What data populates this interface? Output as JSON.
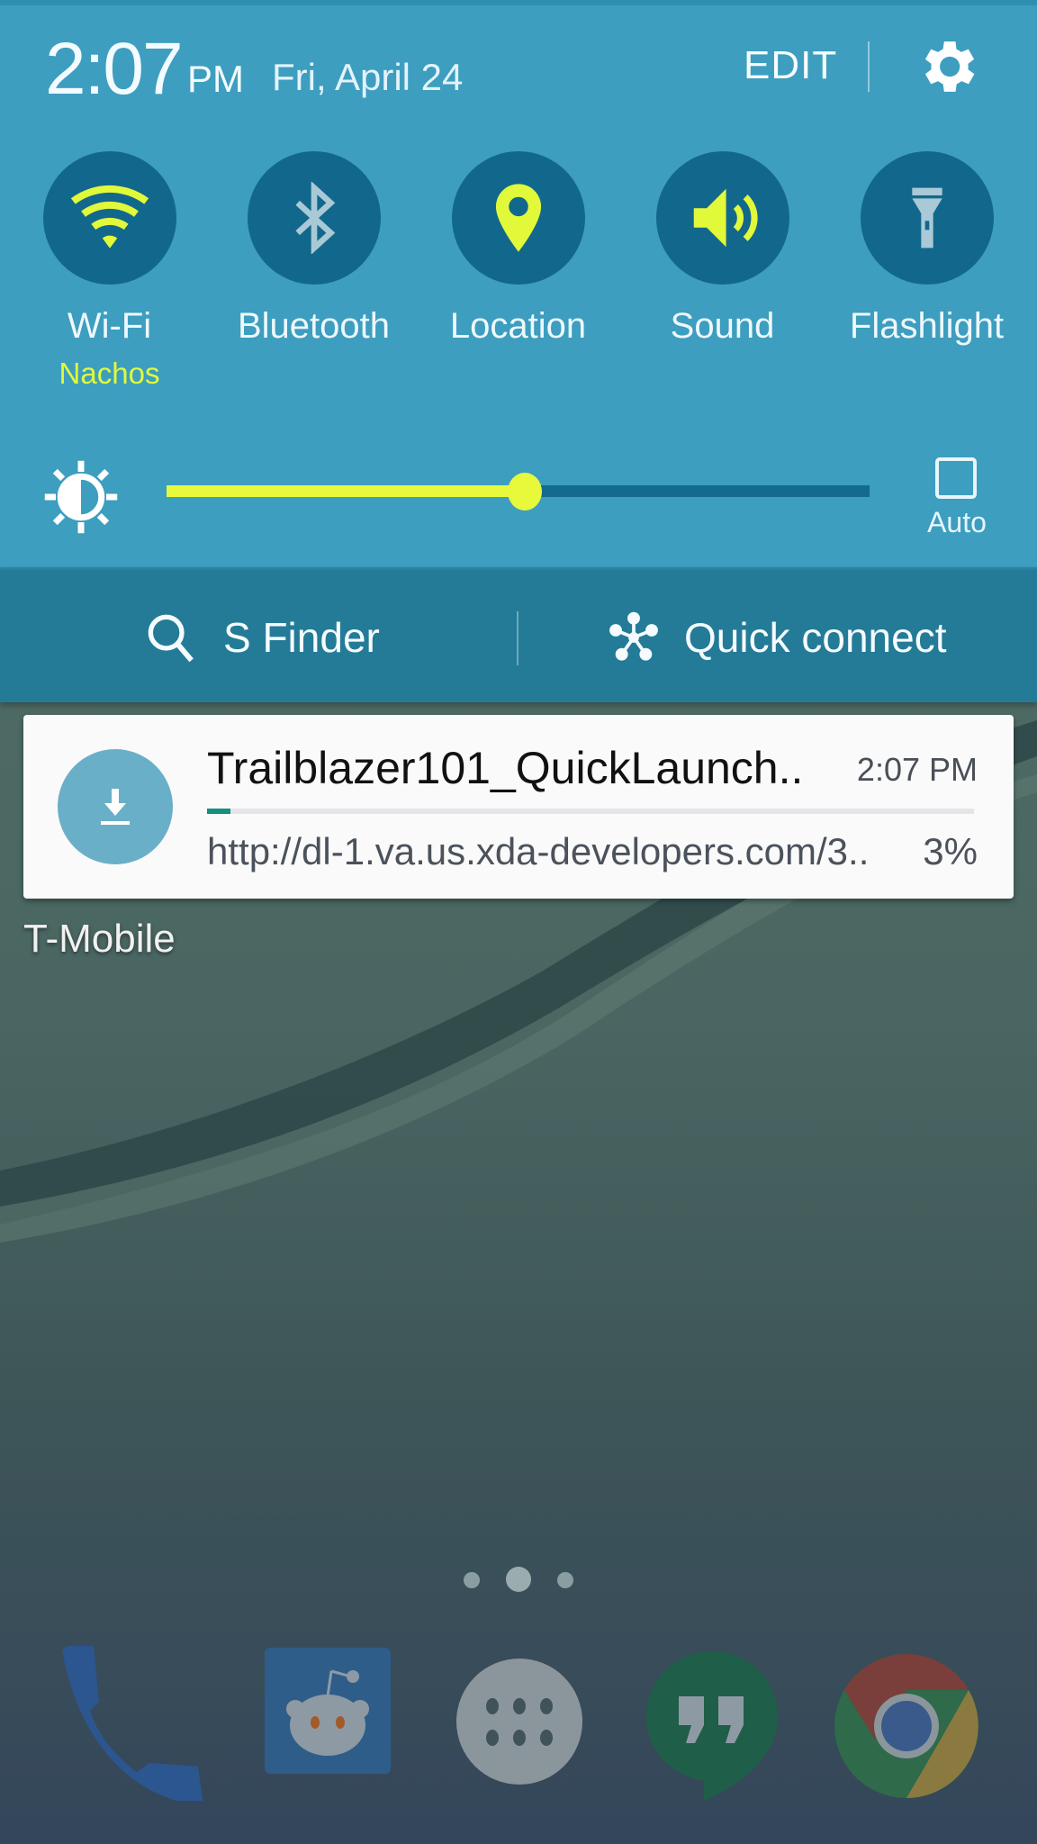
{
  "quick_panel": {
    "time": "2:07",
    "ampm": "PM",
    "date": "Fri, April 24",
    "edit_label": "EDIT",
    "settings_icon": "gear-icon",
    "toggles": [
      {
        "label": "Wi-Fi",
        "sub": "Nachos",
        "icon": "wifi-icon",
        "state": "on"
      },
      {
        "label": "Bluetooth",
        "sub": "",
        "icon": "bluetooth-icon",
        "state": "off"
      },
      {
        "label": "Location",
        "sub": "",
        "icon": "location-pin-icon",
        "state": "on"
      },
      {
        "label": "Sound",
        "sub": "",
        "icon": "sound-icon",
        "state": "on"
      },
      {
        "label": "Flashlight",
        "sub": "",
        "icon": "flashlight-icon",
        "state": "off"
      }
    ],
    "brightness": {
      "level": 0.51,
      "auto_label": "Auto",
      "auto_checked": false
    },
    "s_finder_label": "S Finder",
    "quick_connect_label": "Quick connect",
    "colors": {
      "panel": "#3d9ebf",
      "toggle_bg": "#12688c",
      "accent_on": "#e2f93a",
      "icon_off": "#a9c9d6",
      "bottom_bar": "#247b97"
    }
  },
  "notification": {
    "title": "Trailblazer101_QuickLaunch..",
    "time": "2:07 PM",
    "url": "http://dl-1.va.us.xda-developers.com/3..",
    "progress_percent": 3,
    "progress_label": "3%",
    "icon": "download-icon",
    "progress_color": "#14907e"
  },
  "carrier": "T-Mobile",
  "home": {
    "page_count": 3,
    "current_page": 2,
    "dock_apps": [
      {
        "name": "Phone",
        "icon": "phone-icon"
      },
      {
        "name": "Reddit",
        "icon": "reddit-icon"
      },
      {
        "name": "Apps",
        "icon": "app-drawer-icon"
      },
      {
        "name": "Hangouts",
        "icon": "hangouts-icon"
      },
      {
        "name": "Chrome",
        "icon": "chrome-icon"
      }
    ]
  }
}
